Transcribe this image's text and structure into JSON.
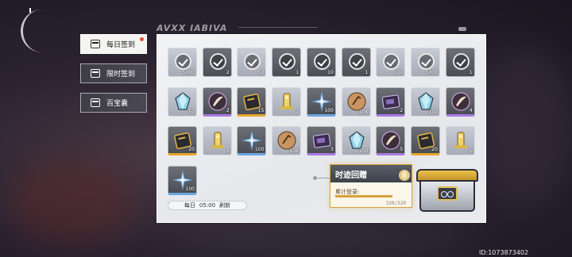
{
  "side_tabs": [
    {
      "label": "每日签到",
      "active": true,
      "badge": true
    },
    {
      "label": "限时签到",
      "active": false
    },
    {
      "label": "百宝囊",
      "active": false
    }
  ],
  "title_deco": "AVXX IABIVA",
  "rows": [
    [
      {
        "icon": "claimed-check",
        "qty": "5000",
        "state": "claimed",
        "rarity": "light"
      },
      {
        "icon": "claimed-check",
        "qty": "2",
        "state": "claimed",
        "rarity": "dark"
      },
      {
        "icon": "claimed-check",
        "qty": "50",
        "state": "claimed",
        "rarity": "light"
      },
      {
        "icon": "claimed-check",
        "qty": "1",
        "state": "claimed",
        "rarity": "dark"
      },
      {
        "icon": "claimed-check",
        "qty": "10",
        "state": "claimed",
        "rarity": "dark"
      },
      {
        "icon": "claimed-check",
        "qty": "1",
        "state": "claimed",
        "rarity": "dark"
      },
      {
        "icon": "claimed-check",
        "qty": "100",
        "state": "claimed",
        "rarity": "light"
      },
      {
        "icon": "claimed-check",
        "qty": "5000",
        "state": "claimed",
        "rarity": "light"
      },
      {
        "icon": "claimed-check",
        "qty": "1",
        "state": "claimed",
        "rarity": "dark"
      }
    ],
    [
      {
        "icon": "crystal-icon",
        "qty": "50",
        "rarity": "light"
      },
      {
        "icon": "feather-orb-icon",
        "qty": "2",
        "rarity": "purple"
      },
      {
        "icon": "gold-book-icon",
        "qty": "15",
        "rarity": "gold"
      },
      {
        "icon": "gold-pillar-icon",
        "qty": "1",
        "rarity": "light"
      },
      {
        "icon": "blue-star-icon",
        "qty": "100",
        "rarity": "blue"
      },
      {
        "icon": "bronze-coin-icon",
        "qty": "10K",
        "rarity": "light"
      },
      {
        "icon": "purple-book-icon",
        "qty": "2",
        "rarity": "purple"
      },
      {
        "icon": "crystal-icon",
        "qty": "100",
        "rarity": "light"
      },
      {
        "icon": "feather-orb-icon",
        "qty": "4",
        "rarity": "purple"
      }
    ],
    [
      {
        "icon": "gold-book-icon",
        "qty": "20",
        "rarity": "gold"
      },
      {
        "icon": "gold-pillar-icon",
        "qty": "1",
        "rarity": "light"
      },
      {
        "icon": "blue-star-icon",
        "qty": "100",
        "rarity": "blue"
      },
      {
        "icon": "bronze-coin-icon",
        "qty": "10K",
        "rarity": "light"
      },
      {
        "icon": "purple-book-icon",
        "qty": "3",
        "rarity": "purple"
      },
      {
        "icon": "crystal-icon",
        "qty": "100",
        "rarity": "light"
      },
      {
        "icon": "feather-orb-icon",
        "qty": "5",
        "rarity": "purple"
      },
      {
        "icon": "gold-book-icon",
        "qty": "20",
        "rarity": "gold"
      },
      {
        "icon": "gold-pillar-icon",
        "qty": "1",
        "rarity": "light"
      }
    ],
    [
      {
        "icon": "blue-star-icon",
        "qty": "100",
        "rarity": "blue"
      }
    ]
  ],
  "refresh": {
    "prefix": "每日",
    "time": "05:00",
    "suffix": "刷新"
  },
  "accumulate": {
    "title": "时迹回赠",
    "label": "累计登录:",
    "current": "320",
    "total": "320",
    "progress_text": "320/320",
    "progress_fraction": 1.0
  },
  "uid": "ID:1073873402"
}
